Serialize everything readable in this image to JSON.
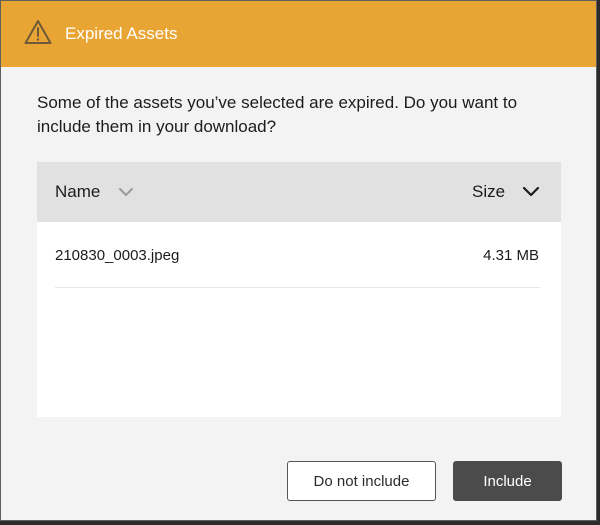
{
  "dialog": {
    "title": "Expired Assets",
    "header_color": "#e9a533",
    "header_icon": "warning-triangle-icon",
    "message": "Some of the assets you’ve selected are expired. Do you want to include them in your download?"
  },
  "table": {
    "columns": [
      {
        "label": "Name",
        "sort_icon": "chevron-down-icon",
        "sort_active": false
      },
      {
        "label": "Size",
        "sort_icon": "chevron-down-icon",
        "sort_active": true
      }
    ],
    "rows": [
      {
        "name": "210830_0003.jpeg",
        "size": "4.31 MB"
      }
    ]
  },
  "buttons": {
    "secondary_label": "Do not include",
    "primary_label": "Include"
  }
}
